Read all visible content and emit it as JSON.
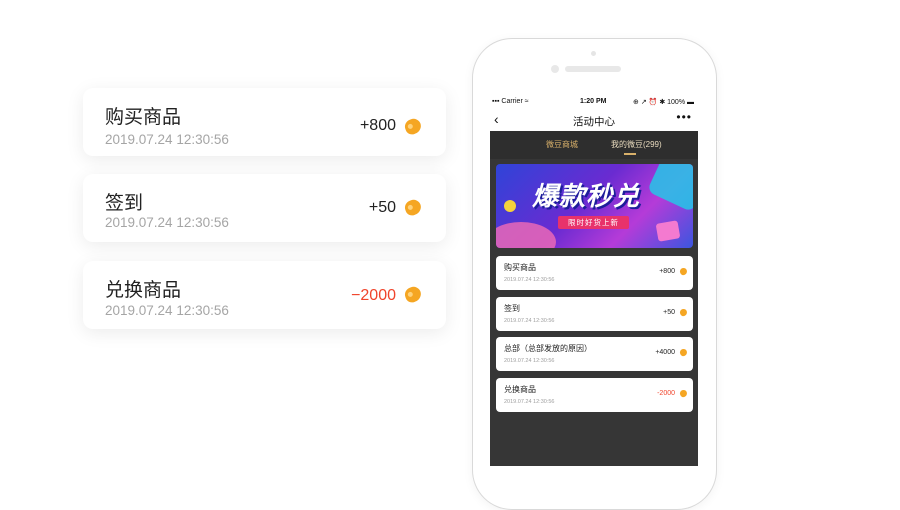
{
  "floating_cards": [
    {
      "title": "购买商品",
      "date": "2019.07.24 12:30:56",
      "amount": "+800",
      "negative": false
    },
    {
      "title": "签到",
      "date": "2019.07.24 12:30:56",
      "amount": "+50",
      "negative": false
    },
    {
      "title": "兑换商品",
      "date": "2019.07.24 12:30:56",
      "amount": "−2000",
      "negative": true
    }
  ],
  "phone": {
    "status_bar": {
      "carrier": "▪▪▪ Carrier ≈",
      "time": "1:20 PM",
      "battery": "⊕ ↗ ⏰ ✱ 100% ▬"
    },
    "nav": {
      "back": "‹",
      "title": "活动中心",
      "more": "•••"
    },
    "tabs": [
      {
        "label": "微豆商城"
      },
      {
        "label": "我的微豆(299)"
      }
    ],
    "banner": {
      "title": "爆款秒兑",
      "subtitle": "限时好货上新"
    },
    "records": [
      {
        "title": "购买商品",
        "date": "2019.07.24 12:30:56",
        "amount": "+800",
        "negative": false
      },
      {
        "title": "签到",
        "date": "2019.07.24 12:30:56",
        "amount": "+50",
        "negative": false
      },
      {
        "title": "总部（总部发放的原因）",
        "date": "2019.07.24 12:30:56",
        "amount": "+4000",
        "negative": false
      },
      {
        "title": "兑换商品",
        "date": "2019.07.24 12:30:56",
        "amount": "-2000",
        "negative": true
      }
    ]
  },
  "colors": {
    "accent_gold": "#d8b06a",
    "negative_red": "#f0442b",
    "bean_orange": "#f5a623",
    "panel_dark": "#363636"
  }
}
